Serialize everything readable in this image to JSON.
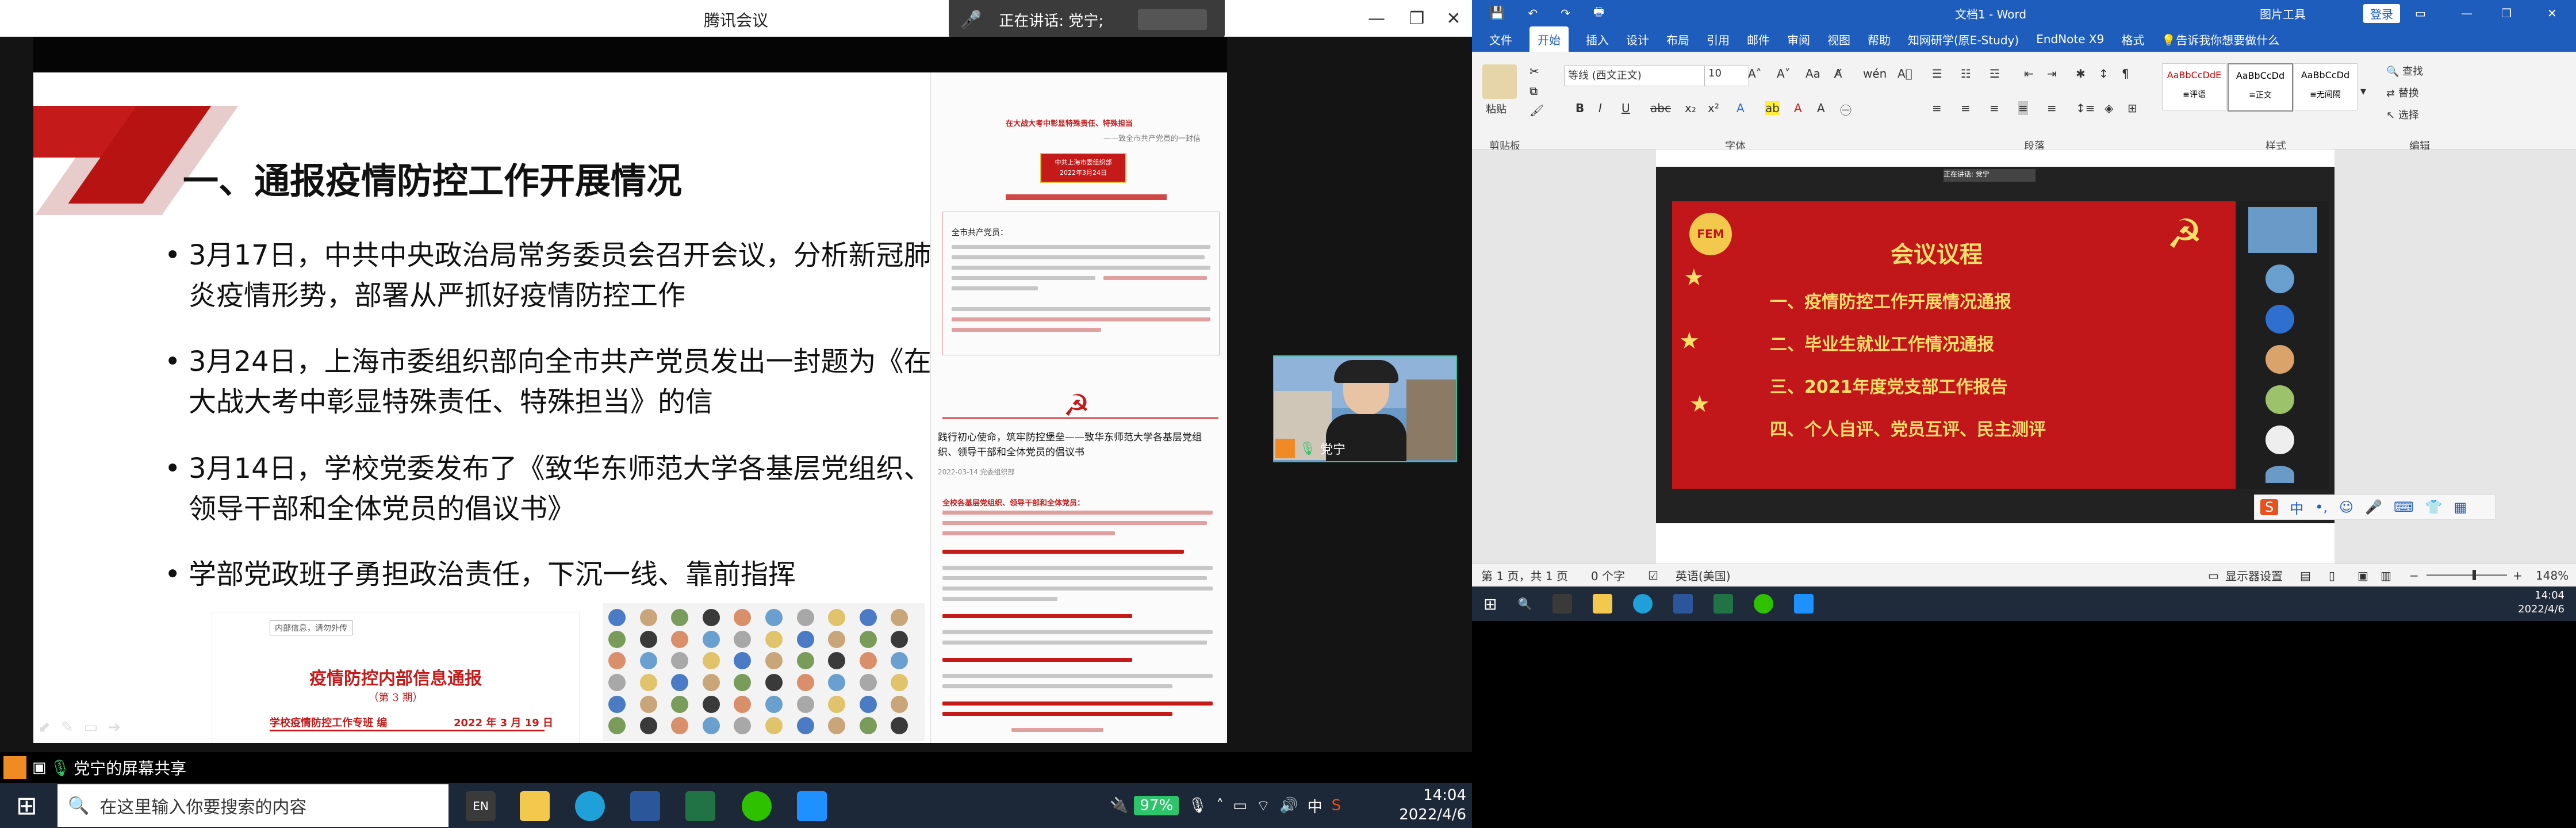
{
  "meeting": {
    "window_title": "腾讯会议",
    "speaking_label": "正在讲话: 党宁;",
    "share_status": "党宁的屏幕共享",
    "camera_name": "党宁"
  },
  "slide": {
    "heading": "一、通报疫情防控工作开展情况",
    "bullets": [
      "3月17日，中共中央政治局常务委员会召开会议，分析新冠肺炎疫情形势，部署从严抓好疫情防控工作",
      "3月24日，上海市委组织部向全市共产党员发出一封题为《在大战大考中彰显特殊责任、特殊担当》的信",
      "3月14日，学校党委发布了《致华东师范大学各基层党组织、领导干部和全体党员的倡议书》",
      "学部党政班子勇担政治责任，下沉一线、靠前指挥"
    ],
    "bulletin": {
      "tag": "内部信息，请勿外传",
      "title": "疫情防控内部信息通报",
      "issue": "（第 3 期）",
      "org": "学校疫情防控工作专班  编",
      "date": "2022 年 3 月 19 日"
    },
    "doc": {
      "red_title": "在大战大考中彰显特殊责任、特殊担当",
      "red_sub": "——致全市共产党员的一封信",
      "badge1": "中共上海市委组织部",
      "badge2": "2022年3月24日",
      "greeting": "全市共产党员：",
      "article_title": "践行初心使命，筑牢防控堡垒——致华东师范大学各基层党组织、领导干部和全体党员的倡议书",
      "article_date": "2022-03-14  党委组织部",
      "section": "全校各基层党组织、领导干部和全体党员："
    }
  },
  "word": {
    "title": "文档1 - Word",
    "tool_label": "图片工具",
    "login": "登录",
    "tabs": [
      "文件",
      "开始",
      "插入",
      "设计",
      "布局",
      "引用",
      "邮件",
      "审阅",
      "视图",
      "帮助",
      "知网研学(原E-Study)",
      "EndNote X9",
      "格式",
      "告诉我你想要做什么"
    ],
    "active_tab": "开始",
    "font_name": "等线 (西文正文)",
    "font_size": "10",
    "paste": "粘贴",
    "groups": [
      "剪贴板",
      "字体",
      "段落",
      "样式",
      "编辑"
    ],
    "styles": [
      {
        "preview": "AaBbCcDdE",
        "name": "≡评语"
      },
      {
        "preview": "AaBbCcDd",
        "name": "≡正文"
      },
      {
        "preview": "AaBbCcDd",
        "name": "≡无间隔"
      }
    ],
    "edit": [
      "查找",
      "替换",
      "选择"
    ],
    "agenda_title": "会议议程",
    "agenda": [
      "一、疫情防控工作开展情况通报",
      "二、毕业生就业工作情况通报",
      "三、2021年度党支部工作报告",
      "四、个人自评、党员互评、民主测评"
    ],
    "embedded_speaking": "正在讲话: 党宁",
    "status_page": "第 1 页，共 1 页",
    "status_words": "0 个字",
    "status_lang": "英语(美国)",
    "status_display": "显示器设置",
    "zoom": "148%",
    "time": "14:04",
    "date": "2022/4/6"
  },
  "taskbar": {
    "search_placeholder": "在这里输入你要搜索的内容",
    "battery": "97%",
    "time": "14:04",
    "date": "2022/4/6"
  }
}
